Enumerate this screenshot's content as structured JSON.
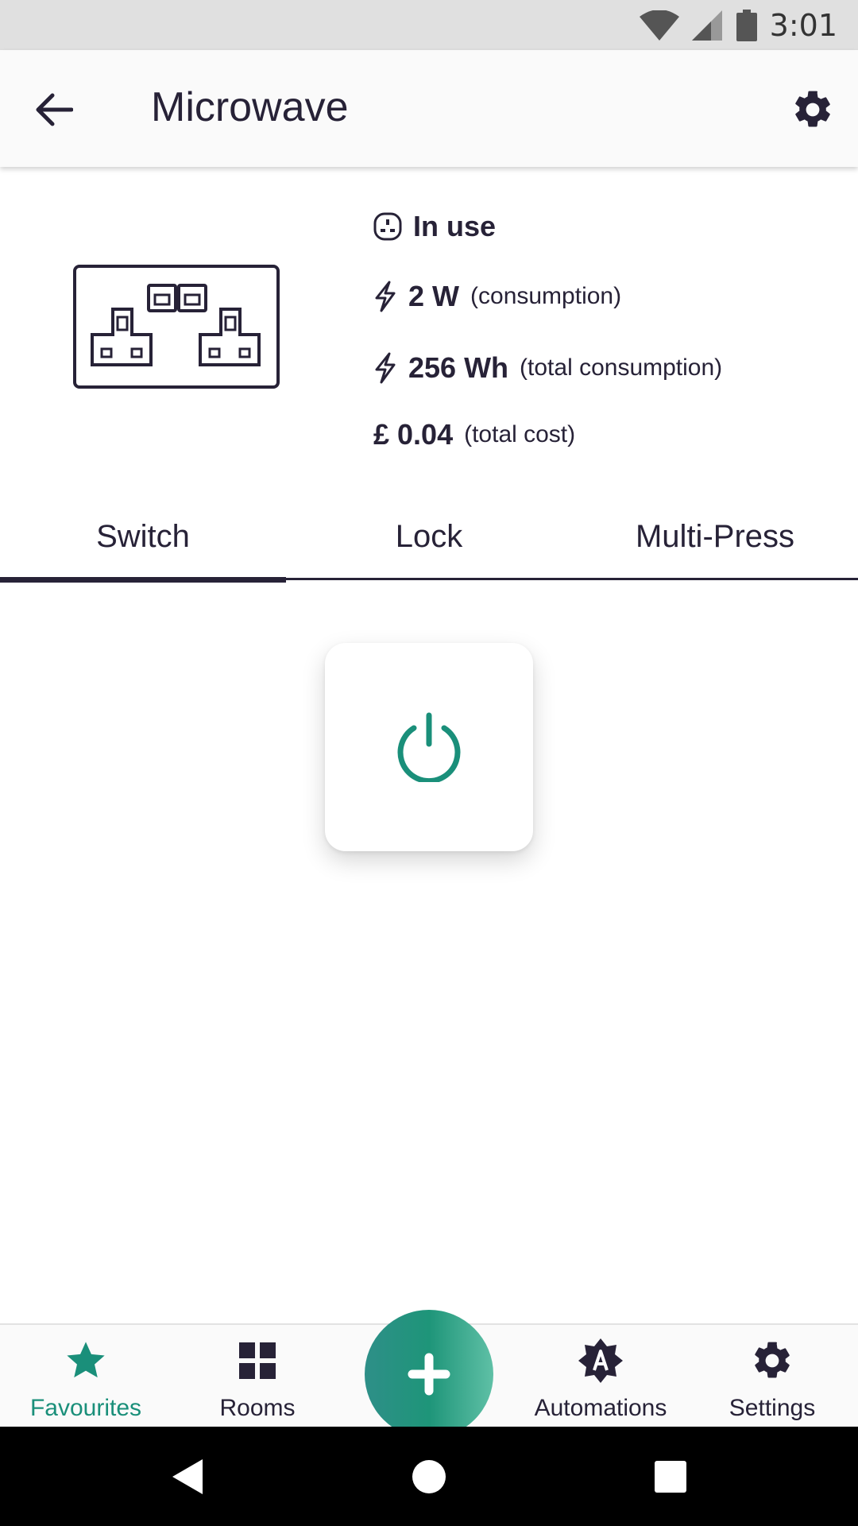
{
  "status_bar": {
    "time": "3:01"
  },
  "app_bar": {
    "title": "Microwave"
  },
  "device": {
    "status": "In use",
    "power": {
      "value": "2 W",
      "label": "(consumption)"
    },
    "energy": {
      "value": "256 Wh",
      "label": "(total consumption)"
    },
    "cost": {
      "value": "£ 0.04",
      "label": "(total cost)"
    }
  },
  "tabs": [
    {
      "label": "Switch",
      "active": true
    },
    {
      "label": "Lock",
      "active": false
    },
    {
      "label": "Multi-Press",
      "active": false
    }
  ],
  "bottom_nav": {
    "items": [
      {
        "label": "Favourites",
        "icon": "star-icon",
        "active": true
      },
      {
        "label": "Rooms",
        "icon": "grid-icon",
        "active": false
      },
      {
        "label": "Automations",
        "icon": "automation-icon",
        "active": false
      },
      {
        "label": "Settings",
        "icon": "gear-icon",
        "active": false
      }
    ],
    "fab_icon": "plus-icon"
  },
  "colors": {
    "accent": "#1a8f7a",
    "text": "#272237",
    "status_bar": "#e0e0e0",
    "app_bar": "#fafafa"
  }
}
